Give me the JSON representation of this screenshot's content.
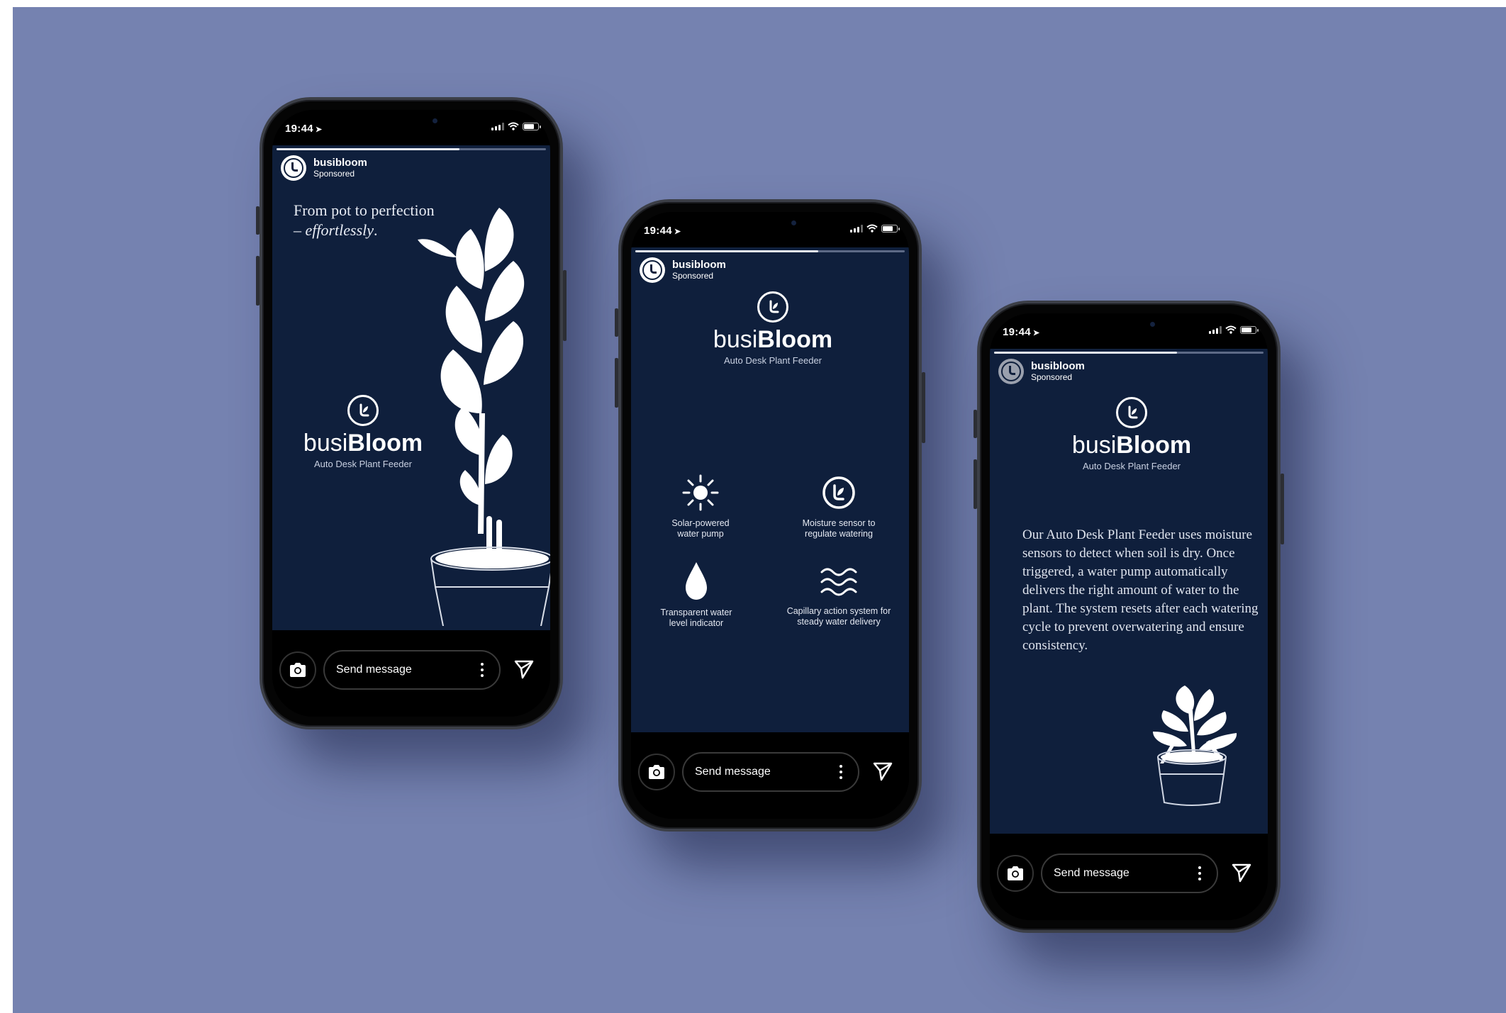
{
  "colors": {
    "backdrop": "#7582b0",
    "story_bg": "#0f1f3c",
    "phone_body": "#050505"
  },
  "phones": [
    {
      "status_time": "19:44",
      "account": {
        "name": "busibloom",
        "subtitle": "Sponsored"
      },
      "headline": {
        "line1": "From pot to perfection",
        "line2_prefix": "– ",
        "line2_em": "effortlessly",
        "line2_suffix": "."
      },
      "logo": {
        "brand_light": "busi",
        "brand_bold": "Bloom",
        "tagline": "Auto Desk Plant Feeder"
      },
      "progress": 0.68,
      "composer": {
        "placeholder": "Send message"
      }
    },
    {
      "status_time": "19:44",
      "account": {
        "name": "busibloom",
        "subtitle": "Sponsored"
      },
      "logo": {
        "brand_light": "busi",
        "brand_bold": "Bloom",
        "tagline": "Auto Desk Plant Feeder"
      },
      "features": [
        {
          "icon": "sun-icon",
          "line1": "Solar-powered",
          "line2": "water pump"
        },
        {
          "icon": "leaf-badge-icon",
          "line1": "Moisture sensor to",
          "line2": "regulate watering"
        },
        {
          "icon": "water-drop-icon",
          "line1": "Transparent water",
          "line2": "level indicator"
        },
        {
          "icon": "waves-icon",
          "line1": "Capillary action system for",
          "line2": "steady water delivery"
        }
      ],
      "progress": 0.68,
      "composer": {
        "placeholder": "Send message"
      }
    },
    {
      "status_time": "19:44",
      "account": {
        "name": "busibloom",
        "subtitle": "Sponsored"
      },
      "logo": {
        "brand_light": "busi",
        "brand_bold": "Bloom",
        "tagline": "Auto Desk Plant Feeder"
      },
      "body": "Our Auto Desk Plant Feeder uses moisture sensors to detect when soil is dry. Once triggered, a water pump automatically delivers the right amount of water to the plant. The system resets after each watering cycle to prevent overwatering and ensure consistency.",
      "progress": 0.68,
      "composer": {
        "placeholder": "Send message"
      }
    }
  ]
}
